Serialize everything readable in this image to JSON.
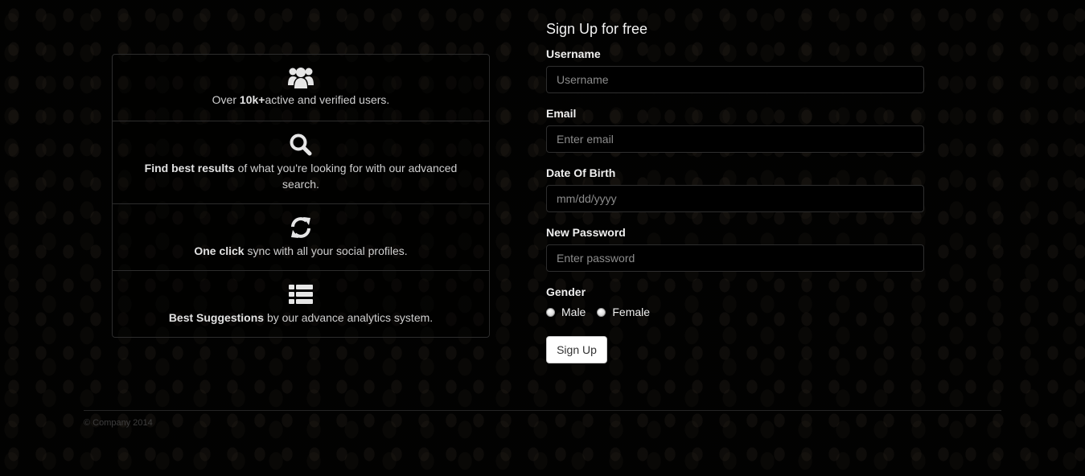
{
  "features": [
    {
      "icon": "users-icon",
      "pre": "Over ",
      "bold": "10k+",
      "post": "active and verified users."
    },
    {
      "icon": "search-icon",
      "pre": "",
      "bold": "Find best results",
      "post": " of what you're looking for with our advanced search."
    },
    {
      "icon": "refresh-icon",
      "pre": "",
      "bold": "One click",
      "post": " sync with all your social profiles."
    },
    {
      "icon": "list-icon",
      "pre": "",
      "bold": "Best Suggestions",
      "post": " by our advance analytics system."
    }
  ],
  "signup": {
    "title": "Sign Up for free",
    "username_label": "Username",
    "username_placeholder": "Username",
    "email_label": "Email",
    "email_placeholder": "Enter email",
    "dob_label": "Date Of Birth",
    "dob_placeholder": "mm/dd/yyyy",
    "password_label": "New Password",
    "password_placeholder": "Enter password",
    "gender_label": "Gender",
    "gender_options": [
      "Male",
      "Female"
    ],
    "submit_label": "Sign Up"
  },
  "footer": {
    "copyright": "© Company 2014"
  },
  "colors": {
    "background": "#0c0b09",
    "icon": "#e6e6e6",
    "input_bg": "#000000"
  }
}
